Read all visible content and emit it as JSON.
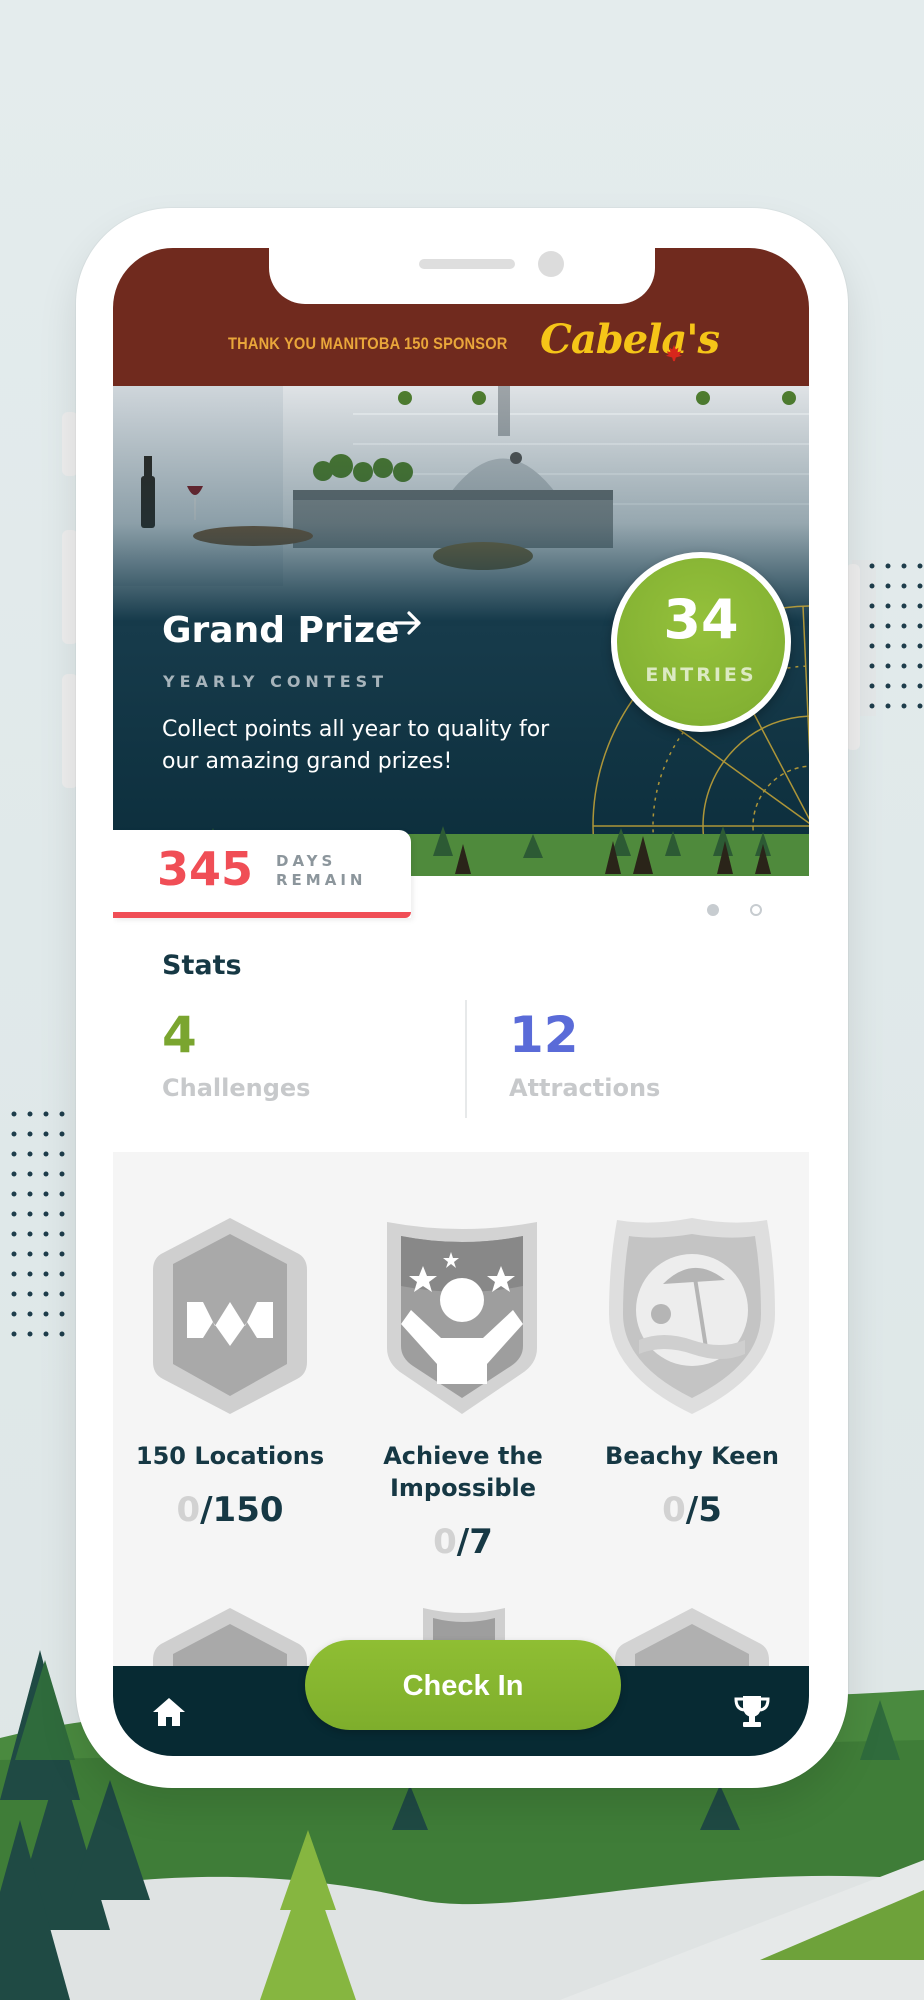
{
  "sponsor": {
    "text": "THANK YOU MANITOBA 150 SPONSOR",
    "brand": "Cabela's",
    "brand_icon": "maple-leaf-icon"
  },
  "hero": {
    "entries_count": "34",
    "entries_label": "ENTRIES",
    "title": "Grand Prize",
    "title_icon": "arrow-right-icon",
    "subtitle": "YEARLY CONTEST",
    "description": "Collect points all year to quality for our amazing grand prizes!"
  },
  "days_remaining": {
    "value": "345",
    "label_line1": "DAYS",
    "label_line2": "REMAIN"
  },
  "pager": {
    "active_index": 0,
    "count": 2
  },
  "stats": {
    "title": "Stats",
    "challenges": {
      "value": "4",
      "label": "Challenges",
      "color": "#7aa52f"
    },
    "attractions": {
      "value": "12",
      "label": "Attractions",
      "color": "#5a6bd8"
    }
  },
  "badges": [
    {
      "name": "150 Locations",
      "progress_current": "0",
      "progress_total": "/150"
    },
    {
      "name_line1": "Achieve the",
      "name_line2": "Impossible",
      "progress_current": "0",
      "progress_total": "/7"
    },
    {
      "name": "Beachy Keen",
      "progress_current": "0",
      "progress_total": "/5"
    }
  ],
  "bottom_nav": {
    "check_in_label": "Check In",
    "home_icon": "home-icon",
    "trophy_icon": "trophy-icon"
  },
  "colors": {
    "sponsor_bar": "#702a1e",
    "accent_green": "#84b233",
    "accent_red": "#f04e56",
    "navy": "#072a33"
  }
}
